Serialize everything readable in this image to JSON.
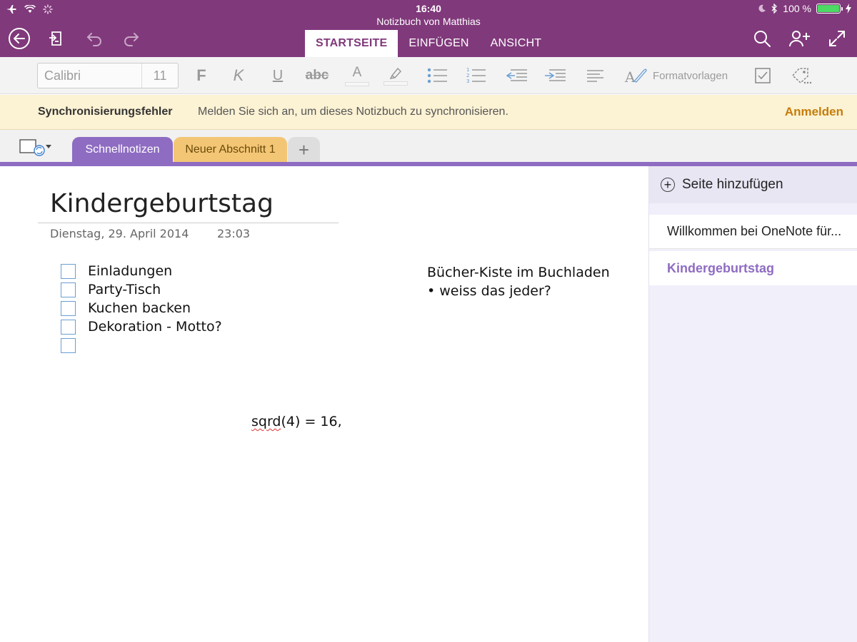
{
  "status_bar": {
    "time": "16:40",
    "battery_text": "100 %",
    "battery_level": 1.0
  },
  "header": {
    "notebook_title": "Notizbuch von Matthias",
    "tabs": [
      {
        "label": "STARTSEITE",
        "active": true
      },
      {
        "label": "EINFÜGEN",
        "active": false
      },
      {
        "label": "ANSICHT",
        "active": false
      }
    ]
  },
  "toolbar": {
    "font_name": "Calibri",
    "font_size": "11",
    "bold_label": "F",
    "italic_label": "K",
    "underline_label": "U",
    "strike_label": "abc",
    "font_color_label": "A",
    "styles_label": "Formatvorlagen"
  },
  "sync": {
    "title": "Synchronisierungsfehler",
    "message": "Melden Sie sich an, um dieses Notizbuch zu synchronisieren.",
    "action": "Anmelden"
  },
  "sections": [
    {
      "label": "Schnellnotizen",
      "color": "#8e6cc2",
      "active": true
    },
    {
      "label": "Neuer Abschnitt 1",
      "color": "#f3c676",
      "active": false
    }
  ],
  "section_add_label": "+",
  "page": {
    "title": "Kindergeburtstag",
    "date": "Dienstag,  29. April 2014",
    "time": "23:03",
    "todo": [
      "Einladungen",
      "Party-Tisch",
      "Kuchen backen",
      "Dekoration - Motto?",
      ""
    ],
    "note_line1": "Bücher-Kiste im Buchladen",
    "note_line2": "• weiss das jeder?",
    "formula_word": "sqrd",
    "formula_rest": "(4) = 16,"
  },
  "page_list": {
    "add_label": "Seite hinzufügen",
    "items": [
      {
        "label": "Willkommen bei OneNote für...",
        "selected": false
      },
      {
        "label": "Kindergeburtstag",
        "selected": true
      }
    ]
  },
  "colors": {
    "accent": "#80397b",
    "section_purple": "#8e6cc2",
    "section_yellow": "#f3c676",
    "sync_action": "#c57d0a"
  }
}
